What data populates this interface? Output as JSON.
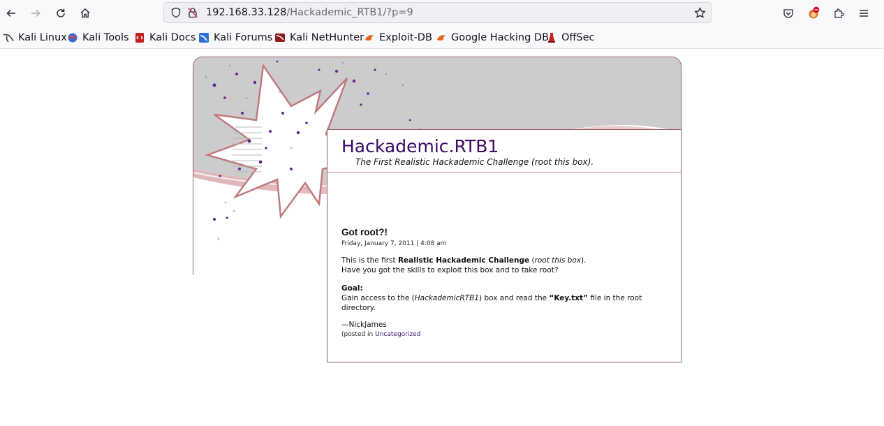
{
  "browser": {
    "url_host": "192.168.33.128",
    "url_path": "/Hackademic_RTB1/?p=9"
  },
  "bookmarks": [
    {
      "label": "Kali Linux",
      "icon": "kali-dragon-icon"
    },
    {
      "label": "Kali Tools",
      "icon": "kali-tools-icon"
    },
    {
      "label": "Kali Docs",
      "icon": "kali-docs-icon"
    },
    {
      "label": "Kali Forums",
      "icon": "kali-forums-icon"
    },
    {
      "label": "Kali NetHunter",
      "icon": "kali-nethunter-icon"
    },
    {
      "label": "Exploit-DB",
      "icon": "exploit-db-icon"
    },
    {
      "label": "Google Hacking DB",
      "icon": "ghdb-icon"
    },
    {
      "label": "OffSec",
      "icon": "offsec-icon"
    }
  ],
  "site": {
    "title": "Hackademic.RTB1",
    "tagline": "The First Realistic Hackademic Challenge (root this box)."
  },
  "post": {
    "title": "Got root?!",
    "date": "Friday, January 7, 2011 | 4:08 am",
    "p1_pre": "This is the first ",
    "p1_bold": "Realistic Hackademic Challenge",
    "p1_mid": " (",
    "p1_italic": "root this box",
    "p1_post": ").",
    "p1_line2": "Have you got the skills to exploit this box and to take root?",
    "goal_label": "Goal:",
    "goal_pre": "Gain access to the (",
    "goal_italic": "HackademicRTB1",
    "goal_mid": ") box and read the ",
    "goal_bold": "“Key.txt”",
    "goal_post": " file in the root directory.",
    "signature": "—NickJames",
    "meta_pre": "(posted in ",
    "meta_link": "Uncategorized"
  },
  "colors": {
    "title": "#3d0a66",
    "accent": "#9b5a62"
  }
}
